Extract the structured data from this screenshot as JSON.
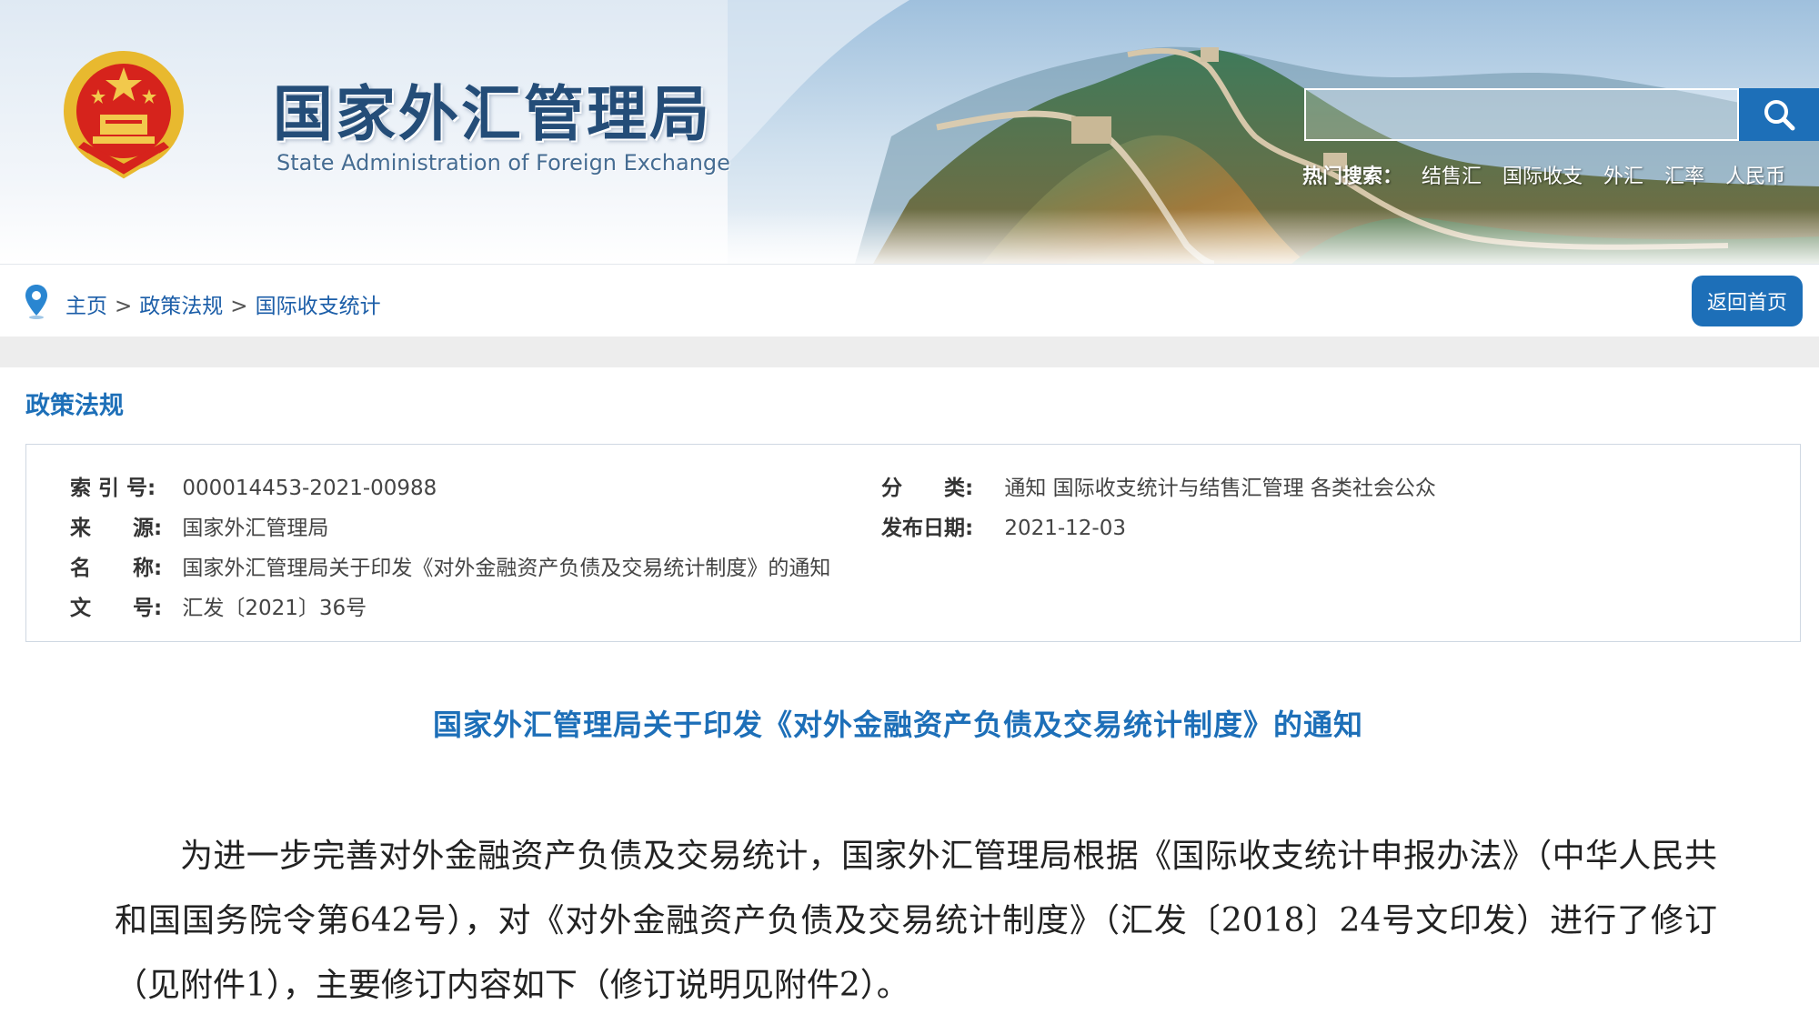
{
  "header": {
    "title": "国家外汇管理局",
    "subtitle": "State Administration of Foreign Exchange",
    "search": {
      "placeholder": ""
    },
    "hot_search": {
      "label": "热门搜索：",
      "links": [
        "结售汇",
        "国际收支",
        "外汇",
        "汇率",
        "人民币"
      ]
    }
  },
  "breadcrumb": {
    "items": [
      "主页",
      "政策法规",
      "国际收支统计"
    ],
    "separator": ">"
  },
  "home_button": "返回首页",
  "section_heading": "政策法规",
  "meta": {
    "index_no": {
      "label": "索 引 号:",
      "value": "000014453-2021-00988"
    },
    "source": {
      "label": "来　　源:",
      "value": "国家外汇管理局"
    },
    "name": {
      "label": "名　　称:",
      "value": "国家外汇管理局关于印发《对外金融资产负债及交易统计制度》的通知"
    },
    "doc_no": {
      "label": "文　　号:",
      "value": "汇发〔2021〕36号"
    },
    "category": {
      "label": "分　　类:",
      "value": "通知 国际收支统计与结售汇管理 各类社会公众"
    },
    "publish_date": {
      "label": "发布日期:",
      "value": "2021-12-03"
    }
  },
  "document": {
    "title": "国家外汇管理局关于印发《对外金融资产负债及交易统计制度》的通知",
    "paragraph": "为进一步完善对外金融资产负债及交易统计，国家外汇管理局根据《国际收支统计申报办法》（中华人民共和国国务院令第642号），对《对外金融资产负债及交易统计制度》（汇发〔2018〕24号文印发）进行了修订（见附件1），主要修订内容如下（修订说明见附件2）。"
  },
  "colors": {
    "brand_blue": "#1d6fb8",
    "link_blue": "#1c5ea8",
    "title_navy": "#244d78"
  },
  "icons": [
    "national-emblem-icon",
    "search-icon",
    "location-pin-icon"
  ]
}
